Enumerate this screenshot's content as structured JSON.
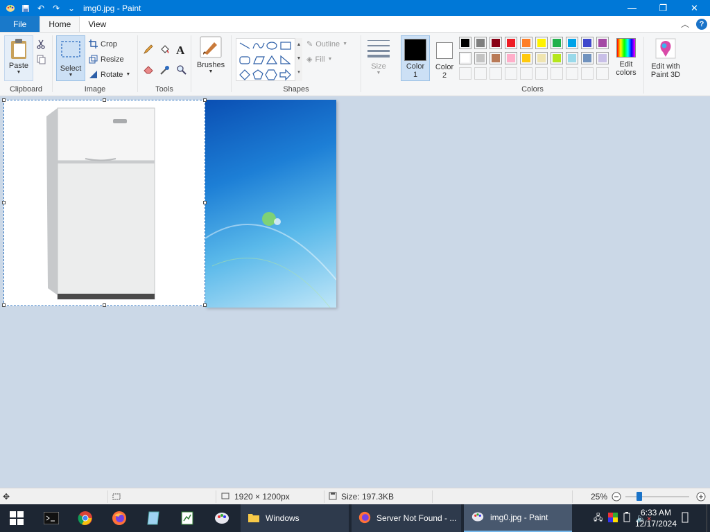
{
  "window": {
    "title": "img0.jpg - Paint",
    "minimize": "—",
    "maximize": "❐",
    "close": "✕"
  },
  "tabs": {
    "file": "File",
    "home": "Home",
    "view": "View"
  },
  "ribbon": {
    "clipboard": {
      "paste": "Paste",
      "group_label": "Clipboard"
    },
    "image": {
      "select": "Select",
      "crop": "Crop",
      "resize": "Resize",
      "rotate": "Rotate",
      "group_label": "Image"
    },
    "tools": {
      "group_label": "Tools"
    },
    "brushes": {
      "label": "Brushes"
    },
    "shapes": {
      "outline": "Outline",
      "fill": "Fill",
      "group_label": "Shapes"
    },
    "size": {
      "label": "Size"
    },
    "colors": {
      "color1": "Color",
      "color1_num": "1",
      "color2": "Color",
      "color2_num": "2",
      "edit_colors_line1": "Edit",
      "edit_colors_line2": "colors",
      "edit_3d_line1": "Edit with",
      "edit_3d_line2": "Paint 3D",
      "group_label": "Colors",
      "color1_value": "#000000",
      "color2_value": "#ffffff",
      "palette_row1": [
        "#000000",
        "#7f7f7f",
        "#880015",
        "#ed1c24",
        "#ff7f27",
        "#fff200",
        "#22b14c",
        "#00a2e8",
        "#3f48cc",
        "#a349a4"
      ],
      "palette_row2": [
        "#ffffff",
        "#c3c3c3",
        "#b97a57",
        "#ffaec9",
        "#ffc90e",
        "#efe4b0",
        "#b5e61d",
        "#99d9ea",
        "#7092be",
        "#c8bfe7"
      ]
    }
  },
  "status": {
    "dimensions": "1920 × 1200px",
    "size": "Size: 197.3KB",
    "zoom": "25%"
  },
  "taskbar": {
    "apps": [
      {
        "label": "Windows"
      },
      {
        "label": "Server Not Found - ..."
      },
      {
        "label": "img0.jpg - Paint"
      }
    ],
    "time": "6:33 AM",
    "date": "12/17/2024"
  }
}
